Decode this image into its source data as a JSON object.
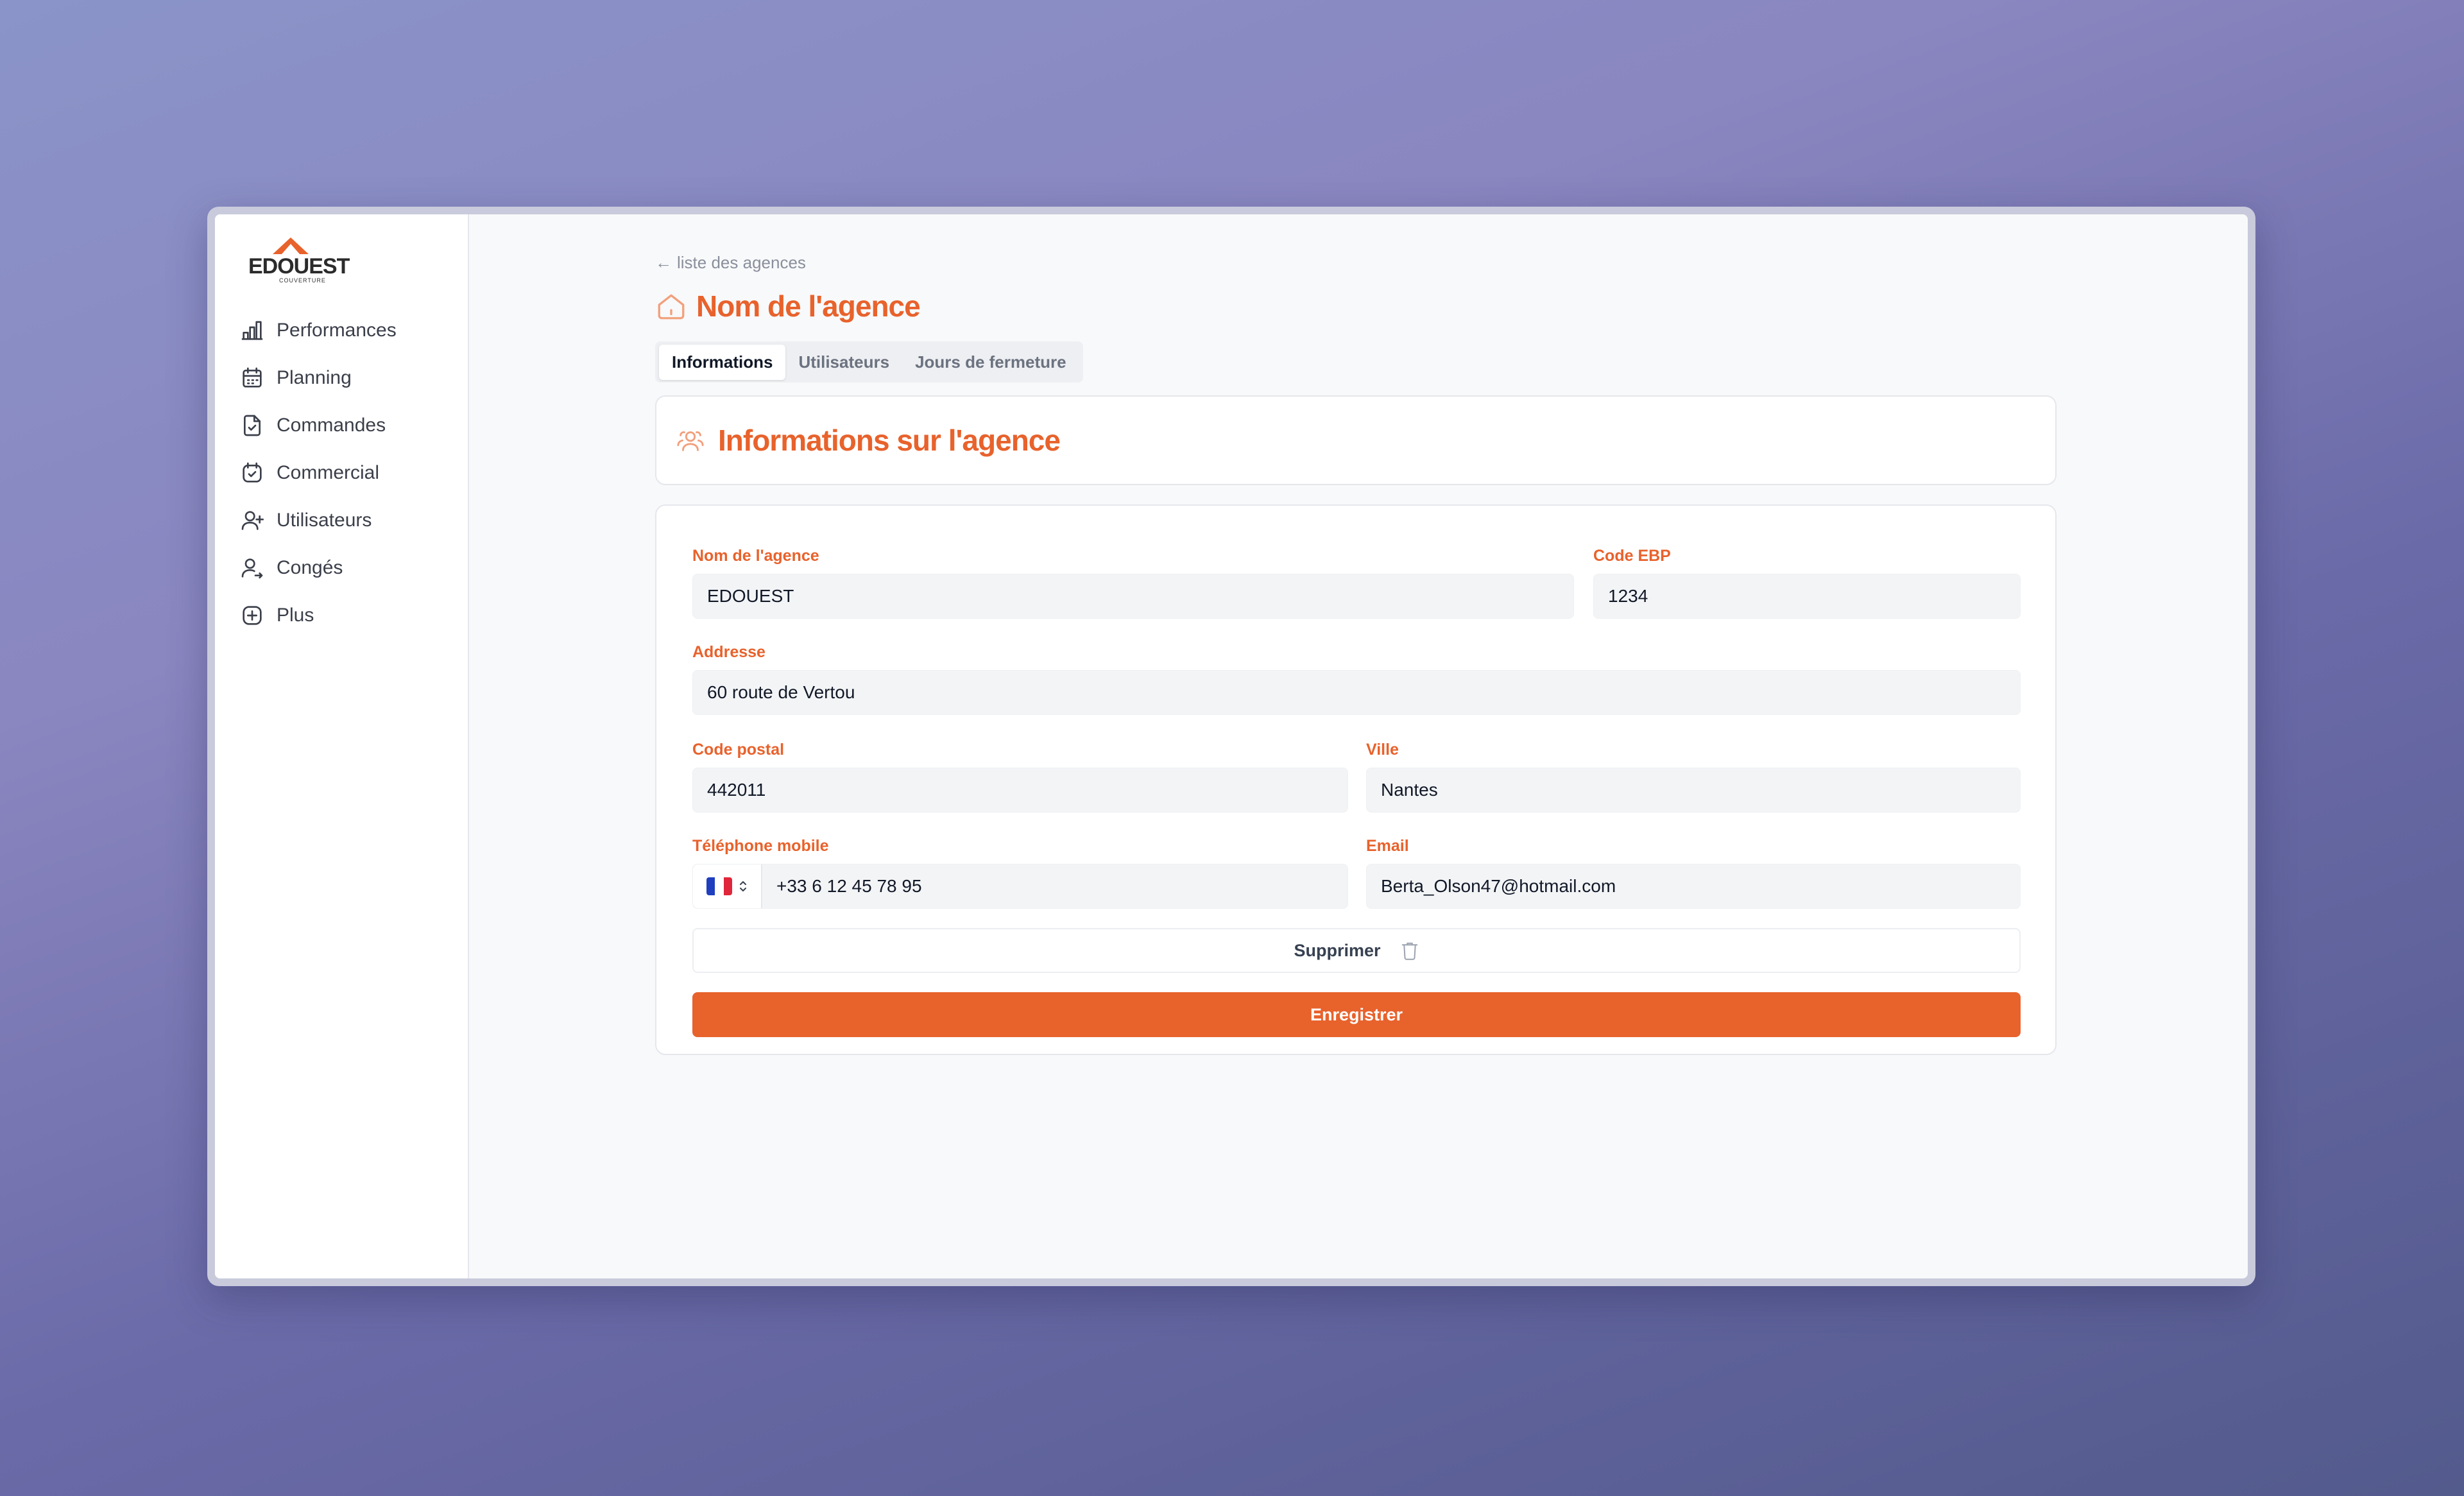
{
  "brand": {
    "logo_text": "EDOUEST",
    "logo_sub": "COUVERTURE",
    "accent_color": "#e8622c"
  },
  "sidebar": {
    "items": [
      {
        "label": "Performances",
        "icon": "bar-chart-icon"
      },
      {
        "label": "Planning",
        "icon": "calendar-icon"
      },
      {
        "label": "Commandes",
        "icon": "file-check-icon"
      },
      {
        "label": "Commercial",
        "icon": "calendar-check-icon"
      },
      {
        "label": "Utilisateurs",
        "icon": "user-plus-icon"
      },
      {
        "label": "Congés",
        "icon": "user-arrow-icon"
      },
      {
        "label": "Plus",
        "icon": "plus-square-icon"
      }
    ]
  },
  "header": {
    "back_link": "liste des agences",
    "title": "Nom de l'agence"
  },
  "tabs": [
    {
      "label": "Informations",
      "active": true
    },
    {
      "label": "Utilisateurs",
      "active": false
    },
    {
      "label": "Jours de fermeture",
      "active": false
    }
  ],
  "section": {
    "title": "Informations sur l'agence"
  },
  "form": {
    "agency_name": {
      "label": "Nom de l'agence",
      "value": "EDOUEST"
    },
    "code_ebp": {
      "label": "Code EBP",
      "value": "1234"
    },
    "address": {
      "label": "Addresse",
      "value": "60 route de Vertou"
    },
    "postal_code": {
      "label": "Code postal",
      "value": "442011"
    },
    "city": {
      "label": "Ville",
      "value": "Nantes"
    },
    "phone": {
      "label": "Téléphone mobile",
      "value": "+33 6 12 45 78 95",
      "country": "FR"
    },
    "email": {
      "label": "Email",
      "value": "Berta_Olson47@hotmail.com"
    }
  },
  "actions": {
    "delete_label": "Supprimer",
    "save_label": "Enregistrer"
  }
}
